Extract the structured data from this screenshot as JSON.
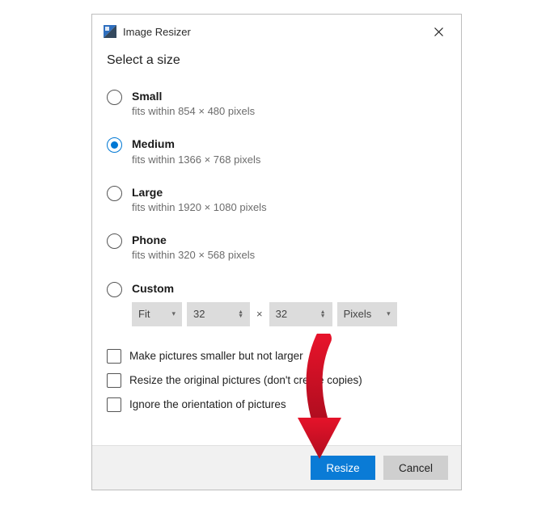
{
  "window": {
    "title": "Image Resizer"
  },
  "heading": "Select a size",
  "sizes": [
    {
      "label": "Small",
      "sub": "fits within 854 × 480 pixels",
      "selected": false
    },
    {
      "label": "Medium",
      "sub": "fits within 1366 × 768 pixels",
      "selected": true
    },
    {
      "label": "Large",
      "sub": "fits within 1920 × 1080 pixels",
      "selected": false
    },
    {
      "label": "Phone",
      "sub": "fits within 320 × 568 pixels",
      "selected": false
    },
    {
      "label": "Custom",
      "sub": "",
      "selected": false
    }
  ],
  "custom": {
    "fit_mode": "Fit",
    "width": "32",
    "height": "32",
    "times_symbol": "×",
    "unit": "Pixels"
  },
  "checks": [
    {
      "label": "Make pictures smaller but not larger",
      "checked": false
    },
    {
      "label": "Resize the original pictures (don't create copies)",
      "checked": false
    },
    {
      "label": "Ignore the orientation of pictures",
      "checked": false
    }
  ],
  "footer": {
    "primary": "Resize",
    "secondary": "Cancel"
  },
  "colors": {
    "accent": "#0a7bd6"
  }
}
